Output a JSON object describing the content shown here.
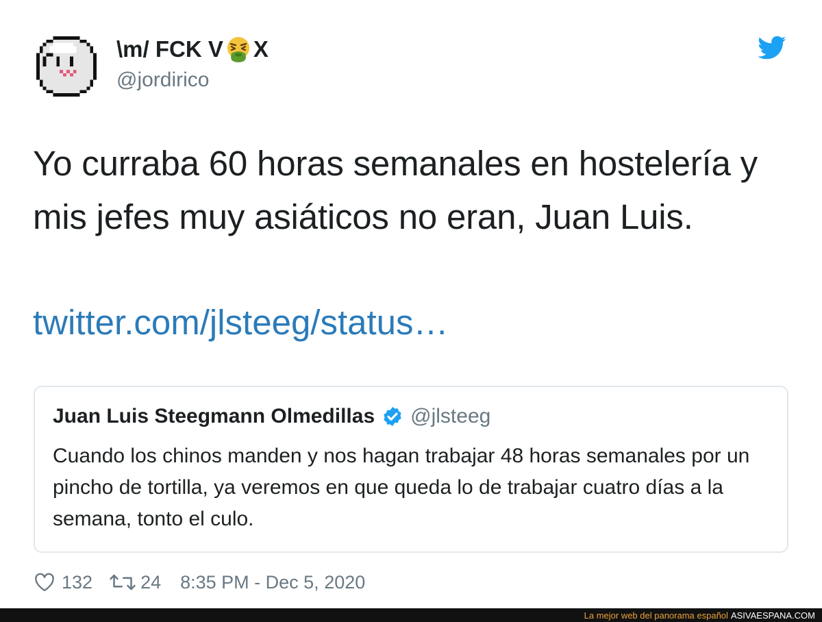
{
  "author": {
    "name_before_emoji": "\\m/ FCK V",
    "name_after_emoji": "X",
    "emoji": "face-vomiting-icon",
    "handle": "@jordirico"
  },
  "tweet": {
    "text": "Yo curraba 60 horas semanales en hostelería y mis jefes muy asiáticos no eran, Juan Luis.",
    "link": "twitter.com/jlsteeg/status…"
  },
  "quoted_tweet": {
    "name": "Juan Luis Steegmann Olmedillas",
    "verified": true,
    "handle": "@jlsteeg",
    "text": "Cuando los chinos manden y nos hagan trabajar 48 horas semanales por un pincho de tortilla, ya veremos en que queda lo de trabajar cuatro días a la semana, tonto el culo."
  },
  "stats": {
    "likes": "132",
    "retweets": "24",
    "timestamp": "8:35 PM - Dec 5, 2020"
  },
  "watermark": {
    "tagline": "La mejor web del panorama español",
    "site": "ASIVAESPANA.COM"
  },
  "colors": {
    "link": "#2b7bb9",
    "twitter_blue": "#1da1f2",
    "muted": "#697882",
    "text": "#1c2022",
    "border": "#e1e8ed"
  }
}
